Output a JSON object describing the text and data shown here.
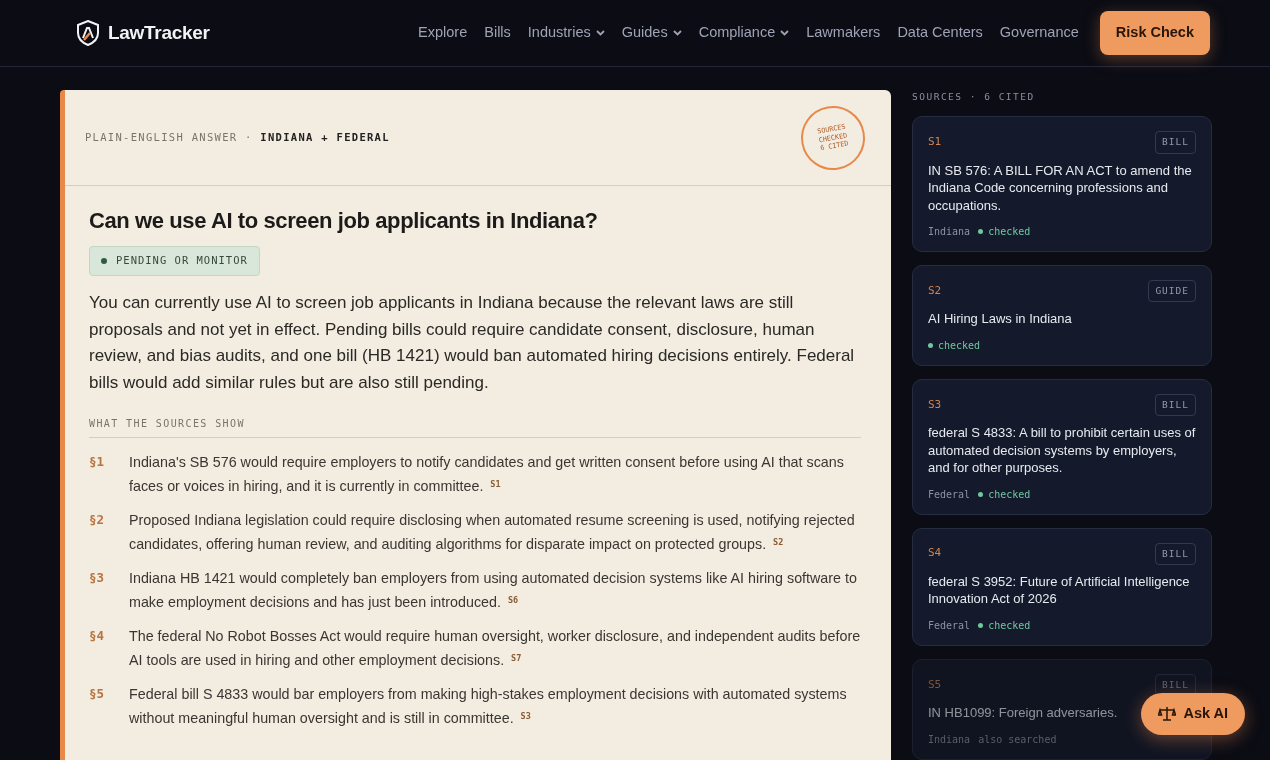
{
  "brand": {
    "name": "LawTracker"
  },
  "nav": [
    {
      "label": "Explore",
      "dropdown": false
    },
    {
      "label": "Bills",
      "dropdown": false
    },
    {
      "label": "Industries",
      "dropdown": true
    },
    {
      "label": "Guides",
      "dropdown": true
    },
    {
      "label": "Compliance",
      "dropdown": true
    },
    {
      "label": "Lawmakers",
      "dropdown": false
    },
    {
      "label": "Data Centers",
      "dropdown": false
    },
    {
      "label": "Governance",
      "dropdown": false
    }
  ],
  "cta": "Risk Check",
  "answer": {
    "kicker": "PLAIN-ENGLISH ANSWER",
    "separator": "·",
    "scope": "INDIANA + FEDERAL",
    "stamp": [
      "SOURCES",
      "CHECKED",
      "6 CITED"
    ],
    "question": "Can we use AI to screen job applicants in Indiana?",
    "status": {
      "label": "PENDING OR MONITOR",
      "color": "#2f5a45"
    },
    "summary": "You can currently use AI to screen job applicants in Indiana because the relevant laws are still proposals and not yet in effect. Pending bills could require candidate consent, disclosure, human review, and bias audits, and one bill (HB 1421) would ban automated hiring decisions entirely. Federal bills would add similar rules but are also still pending.",
    "findings_label": "WHAT THE SOURCES SHOW",
    "findings": [
      {
        "num": "§1",
        "text": "Indiana's SB 576 would require employers to notify candidates and get written consent before using AI that scans faces or voices in hiring, and it is currently in committee. $^{S1}$"
      },
      {
        "num": "§2",
        "text": "Proposed Indiana legislation could require disclosing when automated resume screening is used, notifying rejected candidates, offering human review, and auditing algorithms for disparate impact on protected groups. $^{S2}$"
      },
      {
        "num": "§3",
        "text": "Indiana HB 1421 would completely ban employers from using automated decision systems like AI hiring software to make employment decisions and has just been introduced. $^{S6}$"
      },
      {
        "num": "§4",
        "text": "The federal No Robot Bosses Act would require human oversight, worker disclosure, and independent audits before AI tools are used in hiring and other employment decisions. $^{S7}$"
      },
      {
        "num": "§5",
        "text": "Federal bill S 4833 would bar employers from making high-stakes employment decisions with automated systems without meaningful human oversight and is still in committee. $^{S3}$"
      }
    ]
  },
  "sources": {
    "heading": "SOURCES · 6 CITED",
    "items": [
      {
        "id": "S1",
        "type": "BILL",
        "title": "IN SB 576: A BILL FOR AN ACT to amend the Indiana Code concerning professions and occupations.",
        "jurisdiction": "Indiana",
        "status": "checked",
        "verified": true,
        "faded": false
      },
      {
        "id": "S2",
        "type": "GUIDE",
        "title": "AI Hiring Laws in Indiana",
        "status": "checked",
        "verified": true,
        "faded": false
      },
      {
        "id": "S3",
        "type": "BILL",
        "title": "federal S 4833: A bill to prohibit certain uses of automated decision systems by employers, and for other purposes.",
        "jurisdiction": "Federal",
        "status": "checked",
        "verified": true,
        "faded": false
      },
      {
        "id": "S4",
        "type": "BILL",
        "title": "federal S 3952: Future of Artificial Intelligence Innovation Act of 2026",
        "jurisdiction": "Federal",
        "status": "checked",
        "verified": true,
        "faded": false
      },
      {
        "id": "S5",
        "type": "BILL",
        "title": "IN HB1099: Foreign adversaries.",
        "jurisdiction": "Indiana",
        "status": "also searched",
        "verified": false,
        "faded": true
      }
    ]
  },
  "ask_button": "Ask AI"
}
